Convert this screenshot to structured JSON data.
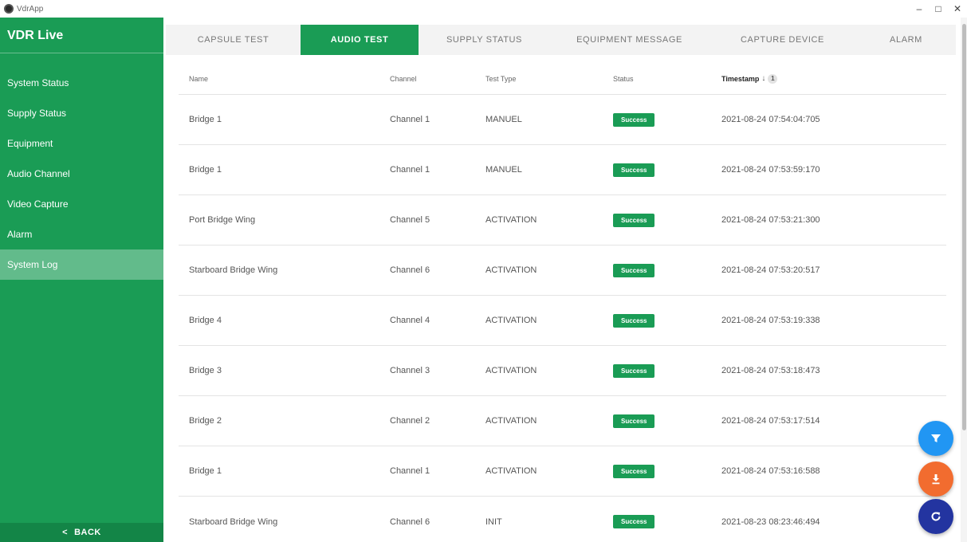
{
  "window": {
    "title": "VdrApp",
    "controls": {
      "minimize": "–",
      "maximize": "□",
      "close": "✕"
    }
  },
  "sidebar": {
    "title": "VDR Live",
    "items": [
      {
        "label": "System Status",
        "active": false
      },
      {
        "label": "Supply Status",
        "active": false
      },
      {
        "label": "Equipment",
        "active": false
      },
      {
        "label": "Audio Channel",
        "active": false
      },
      {
        "label": "Video Capture",
        "active": false
      },
      {
        "label": "Alarm",
        "active": false
      },
      {
        "label": "System Log",
        "active": true
      }
    ],
    "back_arrow": "<",
    "back_label": "BACK"
  },
  "tabs": [
    {
      "label": "CAPSULE TEST",
      "active": false
    },
    {
      "label": "AUDIO TEST",
      "active": true
    },
    {
      "label": "SUPPLY STATUS",
      "active": false
    },
    {
      "label": "EQUIPMENT MESSAGE",
      "active": false
    },
    {
      "label": "CAPTURE DEVICE",
      "active": false
    },
    {
      "label": "ALARM",
      "active": false
    }
  ],
  "table": {
    "headers": {
      "name": "Name",
      "channel": "Channel",
      "test_type": "Test Type",
      "status": "Status",
      "timestamp": "Timestamp",
      "sort_arrow": "↓",
      "sort_order": "1"
    },
    "rows": [
      {
        "name": "Bridge 1",
        "channel": "Channel 1",
        "test_type": "MANUEL",
        "status": "Success",
        "timestamp": "2021-08-24 07:54:04:705"
      },
      {
        "name": "Bridge 1",
        "channel": "Channel 1",
        "test_type": "MANUEL",
        "status": "Success",
        "timestamp": "2021-08-24 07:53:59:170"
      },
      {
        "name": "Port Bridge Wing",
        "channel": "Channel 5",
        "test_type": "ACTIVATION",
        "status": "Success",
        "timestamp": "2021-08-24 07:53:21:300"
      },
      {
        "name": "Starboard Bridge Wing",
        "channel": "Channel 6",
        "test_type": "ACTIVATION",
        "status": "Success",
        "timestamp": "2021-08-24 07:53:20:517"
      },
      {
        "name": "Bridge 4",
        "channel": "Channel 4",
        "test_type": "ACTIVATION",
        "status": "Success",
        "timestamp": "2021-08-24 07:53:19:338"
      },
      {
        "name": "Bridge 3",
        "channel": "Channel 3",
        "test_type": "ACTIVATION",
        "status": "Success",
        "timestamp": "2021-08-24 07:53:18:473"
      },
      {
        "name": "Bridge 2",
        "channel": "Channel 2",
        "test_type": "ACTIVATION",
        "status": "Success",
        "timestamp": "2021-08-24 07:53:17:514"
      },
      {
        "name": "Bridge 1",
        "channel": "Channel 1",
        "test_type": "ACTIVATION",
        "status": "Success",
        "timestamp": "2021-08-24 07:53:16:588"
      },
      {
        "name": "Starboard Bridge Wing",
        "channel": "Channel 6",
        "test_type": "INIT",
        "status": "Success",
        "timestamp": "2021-08-23 08:23:46:494"
      }
    ]
  },
  "fabs": {
    "filter_icon": "filter-icon",
    "download_icon": "download-icon",
    "refresh_icon": "refresh-icon"
  },
  "colors": {
    "primary_green": "#1a9c55",
    "active_nav": "#62bb8b",
    "back_button": "#138547",
    "filter_fab": "#2196f3",
    "download_fab": "#f26c2f",
    "refresh_fab": "#2334a0"
  }
}
